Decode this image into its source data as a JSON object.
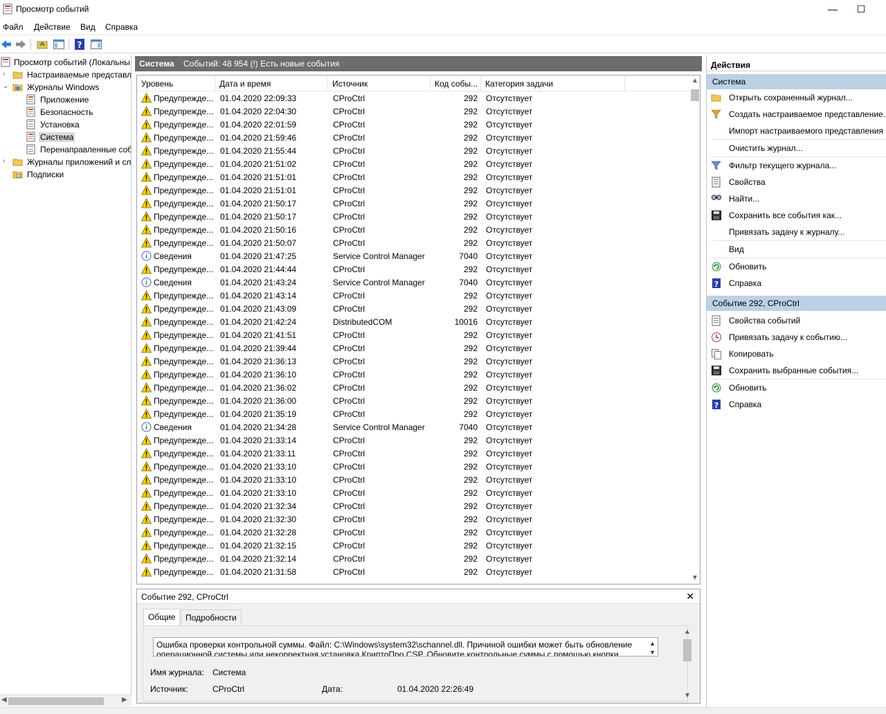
{
  "window": {
    "title": "Просмотр событий",
    "minimize": "—",
    "maximize": "☐"
  },
  "menu": [
    "Файл",
    "Действие",
    "Вид",
    "Справка"
  ],
  "tree": {
    "root": "Просмотр событий (Локальны",
    "items": [
      {
        "label": "Настраиваемые представле",
        "level": 1,
        "arrow": "›"
      },
      {
        "label": "Журналы Windows",
        "level": 1,
        "arrow": "⌄"
      },
      {
        "label": "Приложение",
        "level": 2,
        "arrow": ""
      },
      {
        "label": "Безопасность",
        "level": 2,
        "arrow": ""
      },
      {
        "label": "Установка",
        "level": 2,
        "arrow": ""
      },
      {
        "label": "Система",
        "level": 2,
        "arrow": "",
        "selected": true
      },
      {
        "label": "Перенаправленные соб",
        "level": 2,
        "arrow": ""
      },
      {
        "label": "Журналы приложений и сл",
        "level": 1,
        "arrow": "›"
      },
      {
        "label": "Подписки",
        "level": 1,
        "arrow": ""
      }
    ]
  },
  "center": {
    "header_title": "Система",
    "header_info": "Событий: 48 954 (!) Есть новые события",
    "columns": [
      "Уровень",
      "Дата и время",
      "Источник",
      "Код собы...",
      "Категория задачи"
    ],
    "rows": [
      {
        "level": "warn",
        "level_text": "Предупрежде...",
        "date": "01.04.2020 22:09:33",
        "source": "CProCtrl",
        "code": "292",
        "category": "Отсутствует"
      },
      {
        "level": "warn",
        "level_text": "Предупрежде...",
        "date": "01.04.2020 22:04:30",
        "source": "CProCtrl",
        "code": "292",
        "category": "Отсутствует"
      },
      {
        "level": "warn",
        "level_text": "Предупрежде...",
        "date": "01.04.2020 22:01:59",
        "source": "CProCtrl",
        "code": "292",
        "category": "Отсутствует"
      },
      {
        "level": "warn",
        "level_text": "Предупрежде...",
        "date": "01.04.2020 21:59:46",
        "source": "CProCtrl",
        "code": "292",
        "category": "Отсутствует"
      },
      {
        "level": "warn",
        "level_text": "Предупрежде...",
        "date": "01.04.2020 21:55:44",
        "source": "CProCtrl",
        "code": "292",
        "category": "Отсутствует"
      },
      {
        "level": "warn",
        "level_text": "Предупрежде...",
        "date": "01.04.2020 21:51:02",
        "source": "CProCtrl",
        "code": "292",
        "category": "Отсутствует"
      },
      {
        "level": "warn",
        "level_text": "Предупрежде...",
        "date": "01.04.2020 21:51:01",
        "source": "CProCtrl",
        "code": "292",
        "category": "Отсутствует"
      },
      {
        "level": "warn",
        "level_text": "Предупрежде...",
        "date": "01.04.2020 21:51:01",
        "source": "CProCtrl",
        "code": "292",
        "category": "Отсутствует"
      },
      {
        "level": "warn",
        "level_text": "Предупрежде...",
        "date": "01.04.2020 21:50:17",
        "source": "CProCtrl",
        "code": "292",
        "category": "Отсутствует"
      },
      {
        "level": "warn",
        "level_text": "Предупрежде...",
        "date": "01.04.2020 21:50:17",
        "source": "CProCtrl",
        "code": "292",
        "category": "Отсутствует"
      },
      {
        "level": "warn",
        "level_text": "Предупрежде...",
        "date": "01.04.2020 21:50:16",
        "source": "CProCtrl",
        "code": "292",
        "category": "Отсутствует"
      },
      {
        "level": "warn",
        "level_text": "Предупрежде...",
        "date": "01.04.2020 21:50:07",
        "source": "CProCtrl",
        "code": "292",
        "category": "Отсутствует"
      },
      {
        "level": "info",
        "level_text": "Сведения",
        "date": "01.04.2020 21:47:25",
        "source": "Service Control Manager",
        "code": "7040",
        "category": "Отсутствует"
      },
      {
        "level": "warn",
        "level_text": "Предупрежде...",
        "date": "01.04.2020 21:44:44",
        "source": "CProCtrl",
        "code": "292",
        "category": "Отсутствует"
      },
      {
        "level": "info",
        "level_text": "Сведения",
        "date": "01.04.2020 21:43:24",
        "source": "Service Control Manager",
        "code": "7040",
        "category": "Отсутствует"
      },
      {
        "level": "warn",
        "level_text": "Предупрежде...",
        "date": "01.04.2020 21:43:14",
        "source": "CProCtrl",
        "code": "292",
        "category": "Отсутствует"
      },
      {
        "level": "warn",
        "level_text": "Предупрежде...",
        "date": "01.04.2020 21:43:09",
        "source": "CProCtrl",
        "code": "292",
        "category": "Отсутствует"
      },
      {
        "level": "warn",
        "level_text": "Предупрежде...",
        "date": "01.04.2020 21:42:24",
        "source": "DistributedCOM",
        "code": "10016",
        "category": "Отсутствует"
      },
      {
        "level": "warn",
        "level_text": "Предупрежде...",
        "date": "01.04.2020 21:41:51",
        "source": "CProCtrl",
        "code": "292",
        "category": "Отсутствует"
      },
      {
        "level": "warn",
        "level_text": "Предупрежде...",
        "date": "01.04.2020 21:39:44",
        "source": "CProCtrl",
        "code": "292",
        "category": "Отсутствует"
      },
      {
        "level": "warn",
        "level_text": "Предупрежде...",
        "date": "01.04.2020 21:36:13",
        "source": "CProCtrl",
        "code": "292",
        "category": "Отсутствует"
      },
      {
        "level": "warn",
        "level_text": "Предупрежде...",
        "date": "01.04.2020 21:36:10",
        "source": "CProCtrl",
        "code": "292",
        "category": "Отсутствует"
      },
      {
        "level": "warn",
        "level_text": "Предупрежде...",
        "date": "01.04.2020 21:36:02",
        "source": "CProCtrl",
        "code": "292",
        "category": "Отсутствует"
      },
      {
        "level": "warn",
        "level_text": "Предупрежде...",
        "date": "01.04.2020 21:36:00",
        "source": "CProCtrl",
        "code": "292",
        "category": "Отсутствует"
      },
      {
        "level": "warn",
        "level_text": "Предупрежде...",
        "date": "01.04.2020 21:35:19",
        "source": "CProCtrl",
        "code": "292",
        "category": "Отсутствует"
      },
      {
        "level": "info",
        "level_text": "Сведения",
        "date": "01.04.2020 21:34:28",
        "source": "Service Control Manager",
        "code": "7040",
        "category": "Отсутствует"
      },
      {
        "level": "warn",
        "level_text": "Предупрежде...",
        "date": "01.04.2020 21:33:14",
        "source": "CProCtrl",
        "code": "292",
        "category": "Отсутствует"
      },
      {
        "level": "warn",
        "level_text": "Предупрежде...",
        "date": "01.04.2020 21:33:11",
        "source": "CProCtrl",
        "code": "292",
        "category": "Отсутствует"
      },
      {
        "level": "warn",
        "level_text": "Предупрежде...",
        "date": "01.04.2020 21:33:10",
        "source": "CProCtrl",
        "code": "292",
        "category": "Отсутствует"
      },
      {
        "level": "warn",
        "level_text": "Предупрежде...",
        "date": "01.04.2020 21:33:10",
        "source": "CProCtrl",
        "code": "292",
        "category": "Отсутствует"
      },
      {
        "level": "warn",
        "level_text": "Предупрежде...",
        "date": "01.04.2020 21:33:10",
        "source": "CProCtrl",
        "code": "292",
        "category": "Отсутствует"
      },
      {
        "level": "warn",
        "level_text": "Предупрежде...",
        "date": "01.04.2020 21:32:34",
        "source": "CProCtrl",
        "code": "292",
        "category": "Отсутствует"
      },
      {
        "level": "warn",
        "level_text": "Предупрежде...",
        "date": "01.04.2020 21:32:30",
        "source": "CProCtrl",
        "code": "292",
        "category": "Отсутствует"
      },
      {
        "level": "warn",
        "level_text": "Предупрежде...",
        "date": "01.04.2020 21:32:28",
        "source": "CProCtrl",
        "code": "292",
        "category": "Отсутствует"
      },
      {
        "level": "warn",
        "level_text": "Предупрежде...",
        "date": "01.04.2020 21:32:15",
        "source": "CProCtrl",
        "code": "292",
        "category": "Отсутствует"
      },
      {
        "level": "warn",
        "level_text": "Предупрежде...",
        "date": "01.04.2020 21:32:14",
        "source": "CProCtrl",
        "code": "292",
        "category": "Отсутствует"
      },
      {
        "level": "warn",
        "level_text": "Предупрежде...",
        "date": "01.04.2020 21:31:58",
        "source": "CProCtrl",
        "code": "292",
        "category": "Отсутствует"
      }
    ]
  },
  "details": {
    "title": "Событие 292, CProCtrl",
    "tabs": [
      "Общие",
      "Подробности"
    ],
    "description": "Ошибка проверки контрольной суммы. Файл: C:\\Windows\\system32\\schannel.dll. Причиной ошибки может быть обновление операционной системы или некорректная установка КриптоПро CSP. Обновите контрольные суммы с помощью кнопки",
    "log_name_label": "Имя журнала:",
    "log_name_value": "Система",
    "source_label": "Источник:",
    "source_value": "CProCtrl",
    "date_label": "Дата:",
    "date_value": "01.04.2020 22:26:49"
  },
  "actions": {
    "header": "Действия",
    "section1": "Система",
    "items1": [
      {
        "label": "Открыть сохраненный журнал...",
        "icon": "folder-open-icon"
      },
      {
        "label": "Создать настраиваемое представление...",
        "icon": "filter-new-icon"
      },
      {
        "label": "Импорт настраиваемого представления",
        "icon": ""
      },
      {
        "label": "Очистить журнал...",
        "icon": ""
      },
      {
        "label": "Фильтр текущего журнала...",
        "icon": "filter-icon"
      },
      {
        "label": "Свойства",
        "icon": "properties-icon"
      },
      {
        "label": "Найти...",
        "icon": "find-icon"
      },
      {
        "label": "Сохранить все события как...",
        "icon": "save-icon"
      },
      {
        "label": "Привязать задачу к журналу...",
        "icon": ""
      },
      {
        "label": "Вид",
        "icon": ""
      },
      {
        "label": "Обновить",
        "icon": "refresh-icon"
      },
      {
        "label": "Справка",
        "icon": "help-icon"
      }
    ],
    "section2": "Событие 292, CProCtrl",
    "items2": [
      {
        "label": "Свойства событий",
        "icon": "properties-icon"
      },
      {
        "label": "Привязать задачу к событию...",
        "icon": "task-icon"
      },
      {
        "label": "Копировать",
        "icon": "copy-icon"
      },
      {
        "label": "Сохранить выбранные события...",
        "icon": "save-icon"
      },
      {
        "label": "Обновить",
        "icon": "refresh-icon"
      },
      {
        "label": "Справка",
        "icon": "help-icon"
      }
    ]
  },
  "colors": {
    "header_gray": "#6d6d6d",
    "section_blue": "#bcd1e6",
    "warn_yellow": "#f5d000"
  }
}
